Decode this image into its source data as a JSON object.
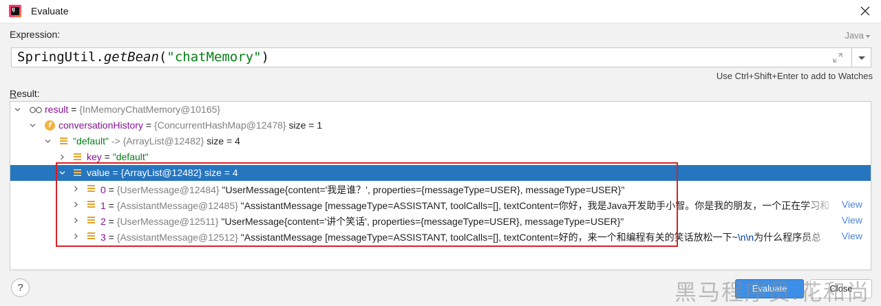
{
  "window": {
    "title": "Evaluate",
    "app_icon_text": "IJ"
  },
  "expression": {
    "label": "Expression:",
    "language": "Java",
    "parts": {
      "class": "SpringUtil.",
      "method": "getBean",
      "open": "(",
      "arg": "\"chatMemory\"",
      "close": ")"
    },
    "hint": "Use Ctrl+Shift+Enter to add to Watches"
  },
  "result": {
    "label_prefix": "R",
    "label_rest": "esult:",
    "rows": [
      {
        "name": "result",
        "eq": " = ",
        "ref": "{InMemoryChatMemory@10165}",
        "rest": ""
      },
      {
        "name": "conversationHistory",
        "eq": " = ",
        "ref": "{ConcurrentHashMap@12478}",
        "rest": "  size = 1"
      },
      {
        "name": "\"default\"",
        "eq": " -> ",
        "ref": "{ArrayList@12482}",
        "rest": "  size = 4"
      },
      {
        "name": "key",
        "eq": " = ",
        "ref": "",
        "rest": "\"default\""
      },
      {
        "name": "value",
        "eq": " = ",
        "ref": "{ArrayList@12482}",
        "rest": "  size = 4"
      },
      {
        "name": "0",
        "eq": " = ",
        "ref": "{UserMessage@12484}",
        "rest": " \"UserMessage{content='我是谁？', properties={messageType=USER}, messageType=USER}\""
      },
      {
        "name": "1",
        "eq": " = ",
        "ref": "{AssistantMessage@12485}",
        "rest": " \"AssistantMessage [messageType=ASSISTANT, toolCalls=[], textContent=你好，我是Java开发助手小智。你是我的朋友，一个正在学习和",
        "link": "View"
      },
      {
        "name": "2",
        "eq": " = ",
        "ref": "{UserMessage@12511}",
        "rest": " \"UserMessage{content='讲个笑话', properties={messageType=USER}, messageType=USER}\"",
        "link": "View"
      },
      {
        "name": "3",
        "eq": " = ",
        "ref": "{AssistantMessage@12512}",
        "rest": " \"AssistantMessage [messageType=ASSISTANT, toolCalls=[], textContent=好的，来一个和编程有关的笑话放松一下~",
        "esc": "\\n\\n",
        "rest2": "为什么程序员总",
        "link": "View"
      }
    ]
  },
  "buttons": {
    "help": "?",
    "evaluate": "Evaluate",
    "close": "Close"
  },
  "watermark": "黑马程序员.花和尚",
  "colors": {
    "selection": "#2675bf",
    "highlight_border": "#d82027",
    "primary_button": "#3d8ee6"
  }
}
